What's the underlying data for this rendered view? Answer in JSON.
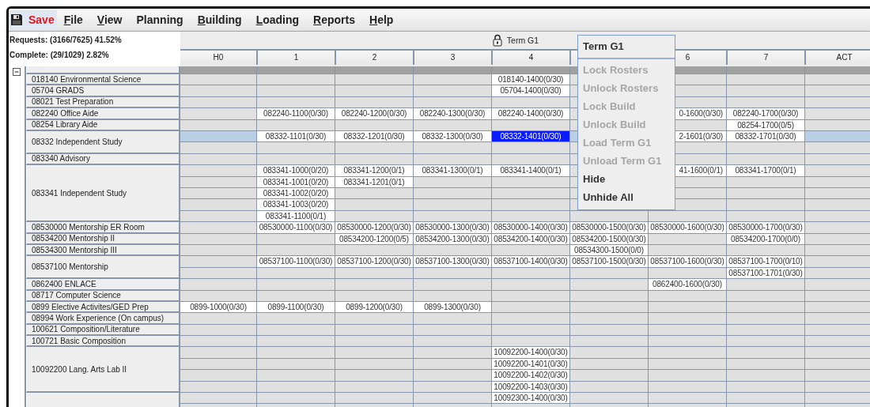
{
  "menu_bar": [
    {
      "label": "Save",
      "kind": "action",
      "mnemonic": false,
      "selected": true
    },
    {
      "label": "File",
      "kind": "menu",
      "mnemonic": true,
      "selected": false
    },
    {
      "label": "View",
      "kind": "menu",
      "mnemonic": true,
      "selected": false
    },
    {
      "label": "Planning",
      "kind": "menu",
      "mnemonic": false,
      "selected": false
    },
    {
      "label": "Building",
      "kind": "menu",
      "mnemonic": true,
      "selected": false
    },
    {
      "label": "Loading",
      "kind": "menu",
      "mnemonic": true,
      "selected": false
    },
    {
      "label": "Reports",
      "kind": "menu",
      "mnemonic": true,
      "selected": false
    },
    {
      "label": "Help",
      "kind": "menu",
      "mnemonic": true,
      "selected": false
    }
  ],
  "stats": [
    "Requests: (3166/7625) 41.52%",
    "Complete: (29/1029) 2.82%"
  ],
  "term": {
    "label": "Term G1"
  },
  "columns": [
    "H0",
    "1",
    "2",
    "3",
    "4",
    null,
    "6",
    "7",
    "ACT"
  ],
  "tree": {
    "expanded": true
  },
  "courses": [
    {
      "name": "018140 Environmental Science",
      "lines": [
        {
          "selected": false,
          "cells": [
            null,
            null,
            null,
            null,
            {
              "text": "018140-1400(0/30)",
              "selected": false
            },
            null,
            null,
            null,
            null
          ]
        }
      ]
    },
    {
      "name": "05704 GRADS",
      "lines": [
        {
          "selected": false,
          "cells": [
            null,
            null,
            null,
            null,
            {
              "text": "05704-1400(0/30)",
              "selected": false
            },
            null,
            null,
            null,
            null
          ]
        }
      ]
    },
    {
      "name": "08021 Test Preparation",
      "lines": [
        {
          "selected": false,
          "cells": [
            null,
            null,
            null,
            null,
            null,
            null,
            null,
            null,
            null
          ]
        }
      ]
    },
    {
      "name": "082240 Office Aide",
      "lines": [
        {
          "selected": false,
          "cells": [
            null,
            {
              "text": "082240-1100(0/30)",
              "selected": false
            },
            {
              "text": "082240-1200(0/30)",
              "selected": false
            },
            {
              "text": "082240-1300(0/30)",
              "selected": false
            },
            {
              "text": "082240-1400(0/30)",
              "selected": false
            },
            null,
            {
              "text": "0-1600(0/30)",
              "selected": false,
              "cut": true
            },
            {
              "text": "082240-1700(0/30)",
              "selected": false
            },
            null
          ]
        }
      ]
    },
    {
      "name": "08254 Library Aide",
      "lines": [
        {
          "selected": false,
          "cells": [
            null,
            null,
            null,
            null,
            null,
            null,
            null,
            {
              "text": "08254-1700(0/5)",
              "selected": false
            },
            null
          ]
        }
      ]
    },
    {
      "name": "08332 Independent Study",
      "lines": [
        {
          "selected": true,
          "cells": [
            null,
            {
              "text": "08332-1101(0/30)",
              "selected": false
            },
            {
              "text": "08332-1201(0/30)",
              "selected": false
            },
            {
              "text": "08332-1300(0/30)",
              "selected": false
            },
            {
              "text": "08332-1401(0/30)",
              "selected": true
            },
            null,
            {
              "text": "2-1601(0/30)",
              "selected": false,
              "cut": true
            },
            {
              "text": "08332-1701(0/30)",
              "selected": false
            },
            null
          ]
        },
        {
          "selected": false,
          "cells": [
            null,
            null,
            null,
            null,
            null,
            null,
            null,
            null,
            null
          ]
        }
      ]
    },
    {
      "name": "083340 Advisory",
      "lines": [
        {
          "selected": false,
          "cells": [
            null,
            null,
            null,
            null,
            null,
            null,
            null,
            null,
            null
          ]
        }
      ]
    },
    {
      "name": "083341 Independent Study",
      "lines": [
        {
          "selected": false,
          "cells": [
            null,
            {
              "text": "083341-1000(0/20)",
              "selected": false
            },
            {
              "text": "083341-1200(0/1)",
              "selected": false
            },
            {
              "text": "083341-1300(0/1)",
              "selected": false
            },
            {
              "text": "083341-1400(0/1)",
              "selected": false
            },
            null,
            {
              "text": "41-1600(0/1)",
              "selected": false,
              "cut": true
            },
            {
              "text": "083341-1700(0/1)",
              "selected": false
            },
            null
          ]
        },
        {
          "selected": false,
          "cells": [
            null,
            {
              "text": "083341-1001(0/20)",
              "selected": false
            },
            {
              "text": "083341-1201(0/1)",
              "selected": false
            },
            null,
            null,
            null,
            null,
            null,
            null
          ]
        },
        {
          "selected": false,
          "cells": [
            null,
            {
              "text": "083341-1002(0/20)",
              "selected": false
            },
            null,
            null,
            null,
            null,
            null,
            null,
            null
          ]
        },
        {
          "selected": false,
          "cells": [
            null,
            {
              "text": "083341-1003(0/20)",
              "selected": false
            },
            null,
            null,
            null,
            null,
            null,
            null,
            null
          ]
        },
        {
          "selected": false,
          "cells": [
            null,
            {
              "text": "083341-1100(0/1)",
              "selected": false
            },
            null,
            null,
            null,
            null,
            null,
            null,
            null
          ]
        }
      ]
    },
    {
      "name": "08530000 Mentorship ER Room",
      "lines": [
        {
          "selected": false,
          "cells": [
            null,
            {
              "text": "08530000-1100(0/30)",
              "selected": false
            },
            {
              "text": "08530000-1200(0/30)",
              "selected": false
            },
            {
              "text": "08530000-1300(0/30)",
              "selected": false
            },
            {
              "text": "08530000-1400(0/30)",
              "selected": false
            },
            {
              "text": "08530000-1500(0/30)",
              "selected": false
            },
            {
              "text": "08530000-1600(0/30)",
              "selected": false
            },
            {
              "text": "08530000-1700(0/30)",
              "selected": false
            },
            null
          ]
        }
      ]
    },
    {
      "name": "08534200 Mentorship II",
      "lines": [
        {
          "selected": false,
          "cells": [
            null,
            null,
            {
              "text": "08534200-1200(0/5)",
              "selected": false
            },
            {
              "text": "08534200-1300(0/30)",
              "selected": false
            },
            {
              "text": "08534200-1400(0/30)",
              "selected": false
            },
            {
              "text": "08534200-1500(0/30)",
              "selected": false
            },
            null,
            {
              "text": "08534200-1700(0/0)",
              "selected": false
            },
            null
          ]
        }
      ]
    },
    {
      "name": "08534300 Mentorship III",
      "lines": [
        {
          "selected": false,
          "cells": [
            null,
            null,
            null,
            null,
            null,
            {
              "text": "08534300-1500(0/0)",
              "selected": false
            },
            null,
            null,
            null
          ]
        }
      ]
    },
    {
      "name": "08537100 Mentorship",
      "lines": [
        {
          "selected": false,
          "cells": [
            null,
            {
              "text": "08537100-1100(0/30)",
              "selected": false
            },
            {
              "text": "08537100-1200(0/30)",
              "selected": false
            },
            {
              "text": "08537100-1300(0/30)",
              "selected": false
            },
            {
              "text": "08537100-1400(0/30)",
              "selected": false
            },
            {
              "text": "08537100-1500(0/30)",
              "selected": false
            },
            {
              "text": "08537100-1600(0/30)",
              "selected": false
            },
            {
              "text": "08537100-1700(0/10)",
              "selected": false
            },
            null
          ]
        },
        {
          "selected": false,
          "cells": [
            null,
            null,
            null,
            null,
            null,
            null,
            null,
            {
              "text": "08537100-1701(0/30)",
              "selected": false
            },
            null
          ]
        }
      ]
    },
    {
      "name": "0862400 ENLACE",
      "lines": [
        {
          "selected": false,
          "cells": [
            null,
            null,
            null,
            null,
            null,
            null,
            {
              "text": "0862400-1600(0/30)",
              "selected": false
            },
            null,
            null
          ]
        }
      ]
    },
    {
      "name": "08717 Computer Science",
      "lines": [
        {
          "selected": false,
          "cells": [
            null,
            null,
            null,
            null,
            null,
            null,
            null,
            null,
            null
          ]
        }
      ]
    },
    {
      "name": "0899 Elective Activites/GED Prep",
      "lines": [
        {
          "selected": false,
          "cells": [
            {
              "text": "0899-1000(0/30)",
              "selected": false
            },
            {
              "text": "0899-1100(0/30)",
              "selected": false
            },
            {
              "text": "0899-1200(0/30)",
              "selected": false
            },
            {
              "text": "0899-1300(0/30)",
              "selected": false
            },
            null,
            null,
            null,
            null,
            null
          ]
        }
      ]
    },
    {
      "name": "08994 Work Experience (On campus)",
      "lines": [
        {
          "selected": false,
          "cells": [
            null,
            null,
            null,
            null,
            null,
            null,
            null,
            null,
            null
          ]
        }
      ]
    },
    {
      "name": "100621 Composition/Literature",
      "lines": [
        {
          "selected": false,
          "cells": [
            null,
            null,
            null,
            null,
            null,
            null,
            null,
            null,
            null
          ]
        }
      ]
    },
    {
      "name": "100721 Basic Composition",
      "lines": [
        {
          "selected": false,
          "cells": [
            null,
            null,
            null,
            null,
            null,
            null,
            null,
            null,
            null
          ]
        }
      ]
    },
    {
      "name": "10092200 Lang. Arts Lab II",
      "lines": [
        {
          "selected": false,
          "cells": [
            null,
            null,
            null,
            null,
            {
              "text": "10092200-1400(0/30)",
              "selected": false
            },
            null,
            null,
            null,
            null
          ]
        },
        {
          "selected": false,
          "cells": [
            null,
            null,
            null,
            null,
            {
              "text": "10092200-1401(0/30)",
              "selected": false
            },
            null,
            null,
            null,
            null
          ]
        },
        {
          "selected": false,
          "cells": [
            null,
            null,
            null,
            null,
            {
              "text": "10092200-1402(0/30)",
              "selected": false
            },
            null,
            null,
            null,
            null
          ]
        },
        {
          "selected": false,
          "cells": [
            null,
            null,
            null,
            null,
            {
              "text": "10092200-1403(0/30)",
              "selected": false
            },
            null,
            null,
            null,
            null
          ]
        }
      ]
    },
    {
      "lines": [
        {
          "selected": false,
          "cells": [
            null,
            null,
            null,
            null,
            {
              "text": "10092300-1400(0/30)",
              "selected": false
            },
            null,
            null,
            null,
            null
          ]
        },
        {
          "selected": false,
          "cells": [
            null,
            null,
            null,
            null,
            null,
            null,
            null,
            null,
            null
          ]
        }
      ]
    }
  ],
  "context_menu": {
    "title": "Term G1",
    "items": [
      {
        "label": "Lock Rosters",
        "disabled": true
      },
      {
        "label": "Unlock Rosters",
        "disabled": true
      },
      {
        "label": "Lock Build",
        "disabled": true
      },
      {
        "label": "Unlock Build",
        "disabled": true
      },
      {
        "label": "Load Term G1",
        "disabled": true
      },
      {
        "label": "Unload Term G1",
        "disabled": true
      },
      {
        "label": "Hide",
        "disabled": false
      },
      {
        "label": "Unhide All",
        "disabled": false
      }
    ]
  }
}
